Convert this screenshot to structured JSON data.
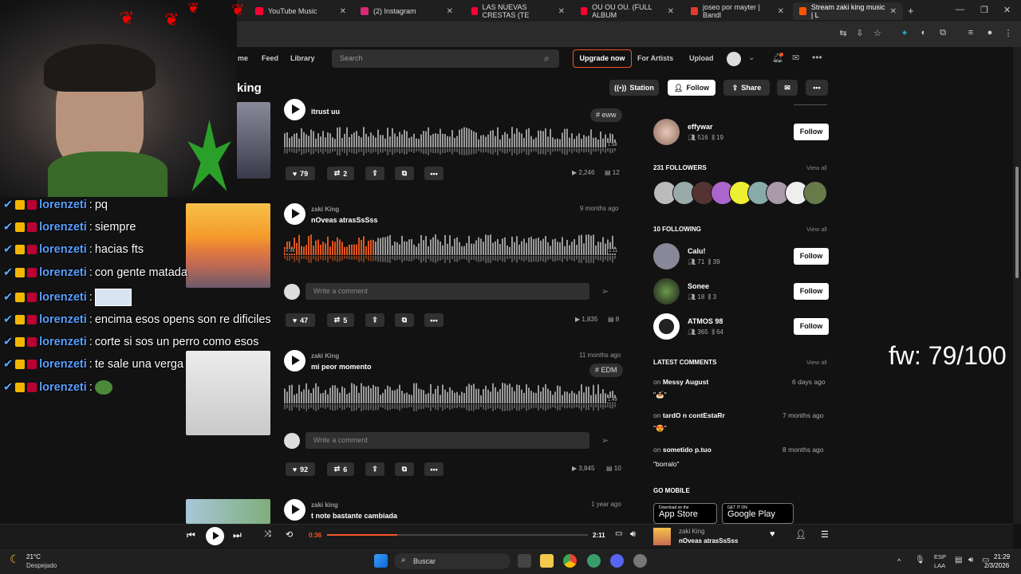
{
  "browser": {
    "tabs": [
      {
        "label": "YouTube Music",
        "color": "#ff0033"
      },
      {
        "label": "(2) Instagram",
        "color": "#d62976"
      },
      {
        "label": "LAS NUEVAS CRESTAS (TE",
        "color": "#ff0033"
      },
      {
        "label": "OU OU OU. (FULL ALBUM",
        "color": "#ff0033"
      },
      {
        "label": "joseo por mayter | Bandl",
        "color": "#e23a2e"
      },
      {
        "label": "Stream zaki king music | L",
        "color": "#ff5500"
      }
    ],
    "new_tab": "+"
  },
  "header": {
    "nav": [
      "me",
      "Feed",
      "Library"
    ],
    "search_placeholder": "Search",
    "upgrade": "Upgrade now",
    "for_artists": "For Artists",
    "upload": "Upload"
  },
  "profile": {
    "name_partial": "king",
    "station": "Station",
    "follow": "Follow",
    "share": "Share"
  },
  "tracks": [
    {
      "artist": "",
      "title": "itrust uu",
      "ago": "",
      "tag": "# eww",
      "duration": "1:58",
      "likes": "79",
      "reposts": "2",
      "plays": "2,246",
      "comments": "12"
    },
    {
      "artist": "zaki King",
      "title": "nOveas atrasSsSss",
      "ago": "9 months ago",
      "tag": "",
      "elapsed": "0:36",
      "duration": "2:11",
      "comment_placeholder": "Write a comment",
      "likes": "47",
      "reposts": "5",
      "plays": "1,835",
      "comments": "8"
    },
    {
      "artist": "zaki King",
      "title": "mi peor momento",
      "ago": "11 months ago",
      "tag": "# EDM",
      "duration": "1:49",
      "comment_placeholder": "Write a comment",
      "likes": "92",
      "reposts": "6",
      "plays": "3,845",
      "comments": "10"
    },
    {
      "artist": "zaki king",
      "title": "t note bastante cambiada",
      "ago": "1 year ago"
    }
  ],
  "sidebar": {
    "top_user": {
      "name": "effywar",
      "followers": "516",
      "tracks": "19",
      "follow": "Follow"
    },
    "followers_heading": "231 FOLLOWERS",
    "following_heading": "10 FOLLOWING",
    "view_all": "View all",
    "following": [
      {
        "name": "Calu!",
        "followers": "71",
        "tracks": "39",
        "follow": "Follow"
      },
      {
        "name": "Sonee",
        "followers": "18",
        "tracks": "3",
        "follow": "Follow"
      },
      {
        "name": "ATMOS 98",
        "followers": "365",
        "tracks": "64",
        "follow": "Follow"
      }
    ],
    "latest_comments_heading": "LATEST COMMENTS",
    "latest_comments": [
      {
        "on": "on",
        "track": "Messy August",
        "ago": "6 days ago",
        "text": "\"🍝\""
      },
      {
        "on": "on",
        "track": "tardO n contEstaRr",
        "ago": "7 months ago",
        "text": "\"😍\""
      },
      {
        "on": "on",
        "track": "sometido p.tuo",
        "ago": "8 months ago",
        "text": "\"borralo\""
      }
    ],
    "go_mobile": "GO MOBILE",
    "app_store": {
      "small": "Download on the",
      "big": "App Store"
    },
    "google_play": {
      "small": "GET IT ON",
      "big": "Google Play"
    }
  },
  "overlay": {
    "chat": [
      {
        "user": "lorenzeti",
        "msg": "pq"
      },
      {
        "user": "lorenzeti",
        "msg": "siempre"
      },
      {
        "user": "lorenzeti",
        "msg": "hacias fts"
      },
      {
        "user": "lorenzeti",
        "msg": "con gente matada"
      },
      {
        "user": "lorenzeti",
        "msg": ""
      },
      {
        "user": "lorenzeti",
        "msg": "encima esos opens son re dificiles"
      },
      {
        "user": "lorenzeti",
        "msg": "corte si sos un perro como esos"
      },
      {
        "user": "lorenzeti",
        "msg": "te sale una verga"
      },
      {
        "user": "lorenzeti",
        "msg": ""
      }
    ],
    "fw": "fw: 79/100"
  },
  "player": {
    "elapsed": "0:36",
    "duration": "2:11",
    "progress": 0.27,
    "artist": "zaki King",
    "title": "nOveas atrasSsSss"
  },
  "taskbar": {
    "temp": "21°C",
    "weather": "Despejado",
    "search": "Buscar",
    "lang1": "ESP",
    "lang2": "LAA",
    "time": "21:29",
    "date": "2/3/2026"
  }
}
